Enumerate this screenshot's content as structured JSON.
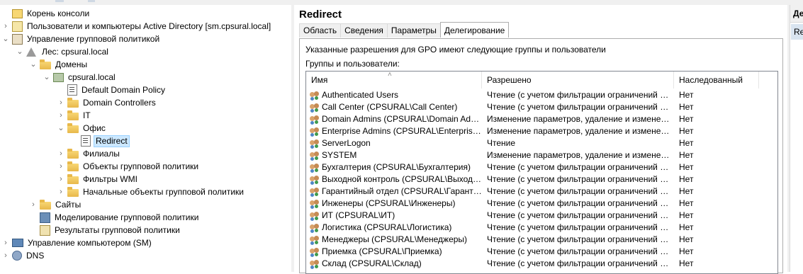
{
  "tree": {
    "nodes": [
      {
        "label": "Корень консоли",
        "icon": "root-folder-icon",
        "chev": ""
      },
      {
        "label": "Пользователи и компьютеры Active Directory [sm.cpsural.local]",
        "icon": "ad-users-icon",
        "chev": ">"
      },
      {
        "label": "Управление групповой политикой",
        "icon": "gpmc-icon",
        "chev": "v"
      },
      {
        "label": "Лес: cpsural.local",
        "icon": "forest-icon",
        "chev": "v"
      },
      {
        "label": "Домены",
        "icon": "folder-icon",
        "chev": "v"
      },
      {
        "label": "cpsural.local",
        "icon": "domain-icon",
        "chev": "v"
      },
      {
        "label": "Default Domain Policy",
        "icon": "gpo-link-icon",
        "chev": ""
      },
      {
        "label": "Domain Controllers",
        "icon": "folder-icon",
        "chev": ">"
      },
      {
        "label": "IT",
        "icon": "folder-icon",
        "chev": ">"
      },
      {
        "label": "Офис",
        "icon": "folder-icon",
        "chev": "v"
      },
      {
        "label": "Redirect",
        "icon": "gpo-link-icon",
        "chev": ""
      },
      {
        "label": "Филиалы",
        "icon": "folder-icon",
        "chev": ">"
      },
      {
        "label": "Объекты групповой политики",
        "icon": "folder-icon",
        "chev": ">"
      },
      {
        "label": "Фильтры WMI",
        "icon": "folder-icon",
        "chev": ">"
      },
      {
        "label": "Начальные объекты групповой политики",
        "icon": "folder-icon",
        "chev": ">"
      },
      {
        "label": "Сайты",
        "icon": "folder-icon",
        "chev": ">"
      },
      {
        "label": "Моделирование групповой политики",
        "icon": "modeling-icon",
        "chev": ""
      },
      {
        "label": "Результаты групповой политики",
        "icon": "results-icon",
        "chev": ""
      },
      {
        "label": "Управление компьютером (SM)",
        "icon": "computer-icon",
        "chev": ">"
      },
      {
        "label": "DNS",
        "icon": "dns-icon",
        "chev": ">"
      }
    ]
  },
  "main": {
    "title": "Redirect",
    "tabs": [
      "Область",
      "Сведения",
      "Параметры",
      "Делегирование"
    ],
    "active_tab": "Делегирование",
    "description": "Указанные разрешения для GPO имеют следующие группы и пользователи",
    "groups_label": "Группы и пользователи:",
    "columns": [
      "Имя",
      "Разрешено",
      "Наследованный"
    ],
    "rows": [
      {
        "name": "Authenticated Users",
        "perm": "Чтение (с учетом фильтрации ограничений безо...",
        "inh": "Нет"
      },
      {
        "name": "Call Center (CPSURAL\\Call Center)",
        "perm": "Чтение (с учетом фильтрации ограничений безо...",
        "inh": "Нет"
      },
      {
        "name": "Domain Admins (CPSURAL\\Domain Admins)",
        "perm": "Изменение параметров, удаление и изменение ...",
        "inh": "Нет"
      },
      {
        "name": "Enterprise Admins (CPSURAL\\Enterprise Admi...",
        "perm": "Изменение параметров, удаление и изменение ...",
        "inh": "Нет"
      },
      {
        "name": "ServerLogon",
        "perm": "Чтение",
        "inh": "Нет"
      },
      {
        "name": "SYSTEM",
        "perm": "Изменение параметров, удаление и изменение ...",
        "inh": "Нет"
      },
      {
        "name": "Бухгалтерия (CPSURAL\\Бухгалтерия)",
        "perm": "Чтение (с учетом фильтрации ограничений безо...",
        "inh": "Нет"
      },
      {
        "name": "Выходной контроль (CPSURAL\\Выходной ...",
        "perm": "Чтение (с учетом фильтрации ограничений безо...",
        "inh": "Нет"
      },
      {
        "name": "Гарантийный отдел (CPSURAL\\Гарантийн...",
        "perm": "Чтение (с учетом фильтрации ограничений безо...",
        "inh": "Нет"
      },
      {
        "name": "Инженеры (CPSURAL\\Инженеры)",
        "perm": "Чтение (с учетом фильтрации ограничений безо...",
        "inh": "Нет"
      },
      {
        "name": "ИТ (CPSURAL\\ИТ)",
        "perm": "Чтение (с учетом фильтрации ограничений безо...",
        "inh": "Нет"
      },
      {
        "name": "Логистика (CPSURAL\\Логистика)",
        "perm": "Чтение (с учетом фильтрации ограничений безо...",
        "inh": "Нет"
      },
      {
        "name": "Менеджеры (CPSURAL\\Менеджеры)",
        "perm": "Чтение (с учетом фильтрации ограничений безо...",
        "inh": "Нет"
      },
      {
        "name": "Приемка (CPSURAL\\Приемка)",
        "perm": "Чтение (с учетом фильтрации ограничений безо...",
        "inh": "Нет"
      },
      {
        "name": "Склад (CPSURAL\\Склад)",
        "perm": "Чтение (с учетом фильтрации ограничений безо...",
        "inh": "Нет"
      }
    ]
  },
  "actions": {
    "header": "Де",
    "item": "Re"
  }
}
